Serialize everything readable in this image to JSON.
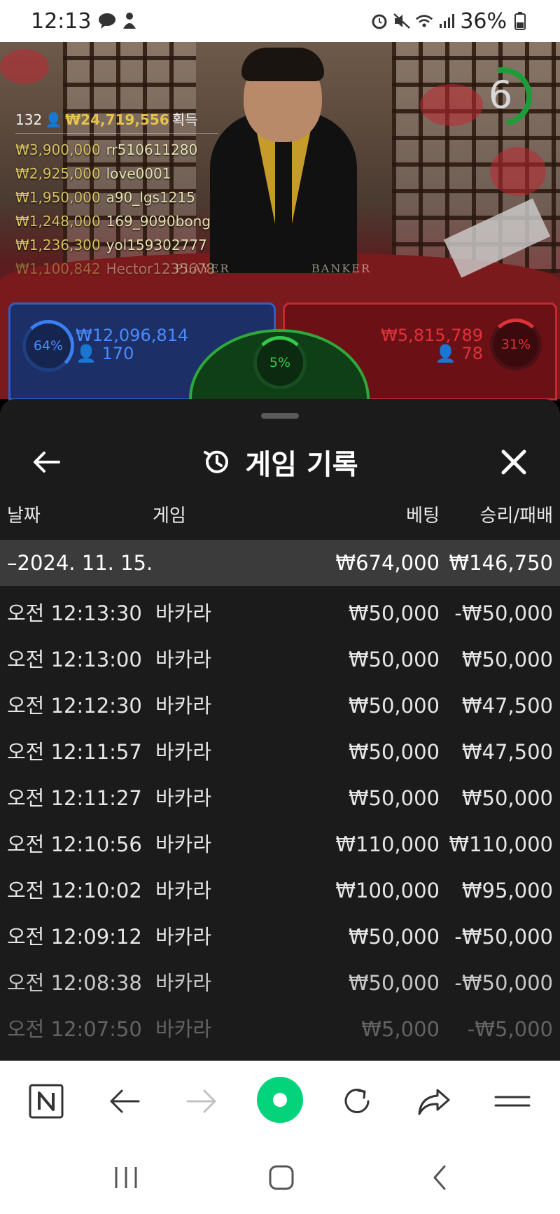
{
  "status_bar": {
    "time": "12:13",
    "battery": "36%",
    "icons": [
      "chat-bubble-icon",
      "gamepad-icon",
      "alarm-icon",
      "mute-icon",
      "wifi-icon",
      "signal-icon",
      "battery-icon"
    ]
  },
  "video": {
    "timer": "6",
    "table_labels": {
      "player": "PLAYER",
      "banker": "BANKER"
    },
    "leaderboard": {
      "count": "132",
      "total": "₩24,719,556",
      "total_suffix": "획득",
      "rows": [
        {
          "amount": "₩3,900,000",
          "user": "rr510611280"
        },
        {
          "amount": "₩2,925,000",
          "user": "love0001"
        },
        {
          "amount": "₩1,950,000",
          "user": "a90_lgs1215"
        },
        {
          "amount": "₩1,248,000",
          "user": "169_9090bong"
        },
        {
          "amount": "₩1,236,300",
          "user": "yol159302777"
        },
        {
          "amount": "₩1,100,842",
          "user": "Hector1235678"
        }
      ]
    },
    "bets": {
      "player": {
        "percent": "64%",
        "amount": "₩12,096,814",
        "players": "170"
      },
      "tie": {
        "percent": "5%"
      },
      "banker": {
        "percent": "31%",
        "amount": "₩5,815,789",
        "players": "78"
      }
    }
  },
  "sheet": {
    "title": "게임 기록",
    "columns": {
      "date": "날짜",
      "game": "게임",
      "bet": "베팅",
      "result": "승리/패배"
    },
    "group": {
      "date": "–2024. 11. 15.",
      "bet": "₩674,000",
      "result": "₩146,750"
    },
    "rows": [
      {
        "time": "오전 12:13:30",
        "game": "바카라",
        "bet": "₩50,000",
        "result": "-₩50,000"
      },
      {
        "time": "오전 12:13:00",
        "game": "바카라",
        "bet": "₩50,000",
        "result": "₩50,000"
      },
      {
        "time": "오전 12:12:30",
        "game": "바카라",
        "bet": "₩50,000",
        "result": "₩47,500"
      },
      {
        "time": "오전 12:11:57",
        "game": "바카라",
        "bet": "₩50,000",
        "result": "₩47,500"
      },
      {
        "time": "오전 12:11:27",
        "game": "바카라",
        "bet": "₩50,000",
        "result": "₩50,000"
      },
      {
        "time": "오전 12:10:56",
        "game": "바카라",
        "bet": "₩110,000",
        "result": "₩110,000"
      },
      {
        "time": "오전 12:10:02",
        "game": "바카라",
        "bet": "₩100,000",
        "result": "₩95,000"
      },
      {
        "time": "오전 12:09:12",
        "game": "바카라",
        "bet": "₩50,000",
        "result": "-₩50,000"
      },
      {
        "time": "오전 12:08:38",
        "game": "바카라",
        "bet": "₩50,000",
        "result": "-₩50,000"
      },
      {
        "time": "오전 12:07:50",
        "game": "바카라",
        "bet": "₩5,000",
        "result": "-₩5,000"
      }
    ]
  },
  "colors": {
    "sheet_bg": "#1b1b1b",
    "group_row_bg": "#3b3b3b",
    "player_blue": "#3a7ff0",
    "banker_red": "#e0313a",
    "tie_green": "#35c94b",
    "gold": "#e6c34a",
    "naver_green": "#03d37a"
  }
}
